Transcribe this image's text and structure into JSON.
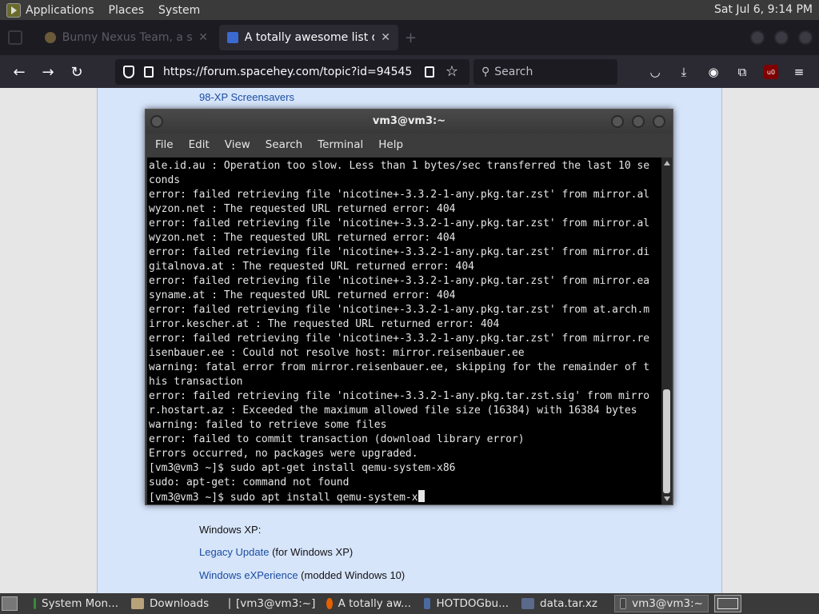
{
  "top_panel": {
    "menus": [
      "Applications",
      "Places",
      "System"
    ],
    "clock": "Sat Jul 6,  9:14 PM"
  },
  "browser": {
    "tabs": [
      {
        "title": "Bunny Nexus Team, a sea",
        "active": false
      },
      {
        "title": "A totally awesome list of \"ol",
        "active": true
      }
    ],
    "url": "https://forum.spacehey.com/topic?id=94545",
    "search_placeholder": "Search"
  },
  "page": {
    "top_link": "98-XP Screensavers",
    "section_heading": "Windows XP:",
    "items": [
      {
        "link": "Legacy Update",
        "rest": " (for Windows XP)"
      },
      {
        "link": "Windows eXPerience",
        "rest": " (modded Windows 10)"
      }
    ]
  },
  "terminal": {
    "title": "vm3@vm3:~",
    "menu": [
      "File",
      "Edit",
      "View",
      "Search",
      "Terminal",
      "Help"
    ],
    "lines": [
      "ale.id.au : Operation too slow. Less than 1 bytes/sec transferred the last 10 se",
      "conds",
      "error: failed retrieving file 'nicotine+-3.3.2-1-any.pkg.tar.zst' from mirror.al",
      "wyzon.net : The requested URL returned error: 404",
      "error: failed retrieving file 'nicotine+-3.3.2-1-any.pkg.tar.zst' from mirror.al",
      "wyzon.net : The requested URL returned error: 404",
      "error: failed retrieving file 'nicotine+-3.3.2-1-any.pkg.tar.zst' from mirror.di",
      "gitalnova.at : The requested URL returned error: 404",
      "error: failed retrieving file 'nicotine+-3.3.2-1-any.pkg.tar.zst' from mirror.ea",
      "syname.at : The requested URL returned error: 404",
      "error: failed retrieving file 'nicotine+-3.3.2-1-any.pkg.tar.zst' from at.arch.m",
      "irror.kescher.at : The requested URL returned error: 404",
      "error: failed retrieving file 'nicotine+-3.3.2-1-any.pkg.tar.zst' from mirror.re",
      "isenbauer.ee : Could not resolve host: mirror.reisenbauer.ee",
      "warning: fatal error from mirror.reisenbauer.ee, skipping for the remainder of t",
      "his transaction",
      "error: failed retrieving file 'nicotine+-3.3.2-1-any.pkg.tar.zst.sig' from mirro",
      "r.hostart.az : Exceeded the maximum allowed file size (16384) with 16384 bytes",
      "warning: failed to retrieve some files",
      "error: failed to commit transaction (download library error)",
      "Errors occurred, no packages were upgraded.",
      "[vm3@vm3 ~]$ sudo apt-get install qemu-system-x86",
      "sudo: apt-get: command not found",
      "[vm3@vm3 ~]$ sudo apt install qemu-system-x"
    ]
  },
  "taskbar": {
    "tasks": [
      {
        "label": "System Mon...",
        "color": "#3a8a3a"
      },
      {
        "label": "Downloads",
        "color": "#b8a27a"
      },
      {
        "label": "[vm3@vm3:~]",
        "color": "#444444"
      },
      {
        "label": "A totally aw...",
        "color": "#e66000"
      },
      {
        "label": "HOTDOGbu...",
        "color": "#4a6aa0"
      },
      {
        "label": "data.tar.xz",
        "color": "#5a6a8a"
      },
      {
        "label": "vm3@vm3:~",
        "color": "#444444"
      }
    ]
  }
}
